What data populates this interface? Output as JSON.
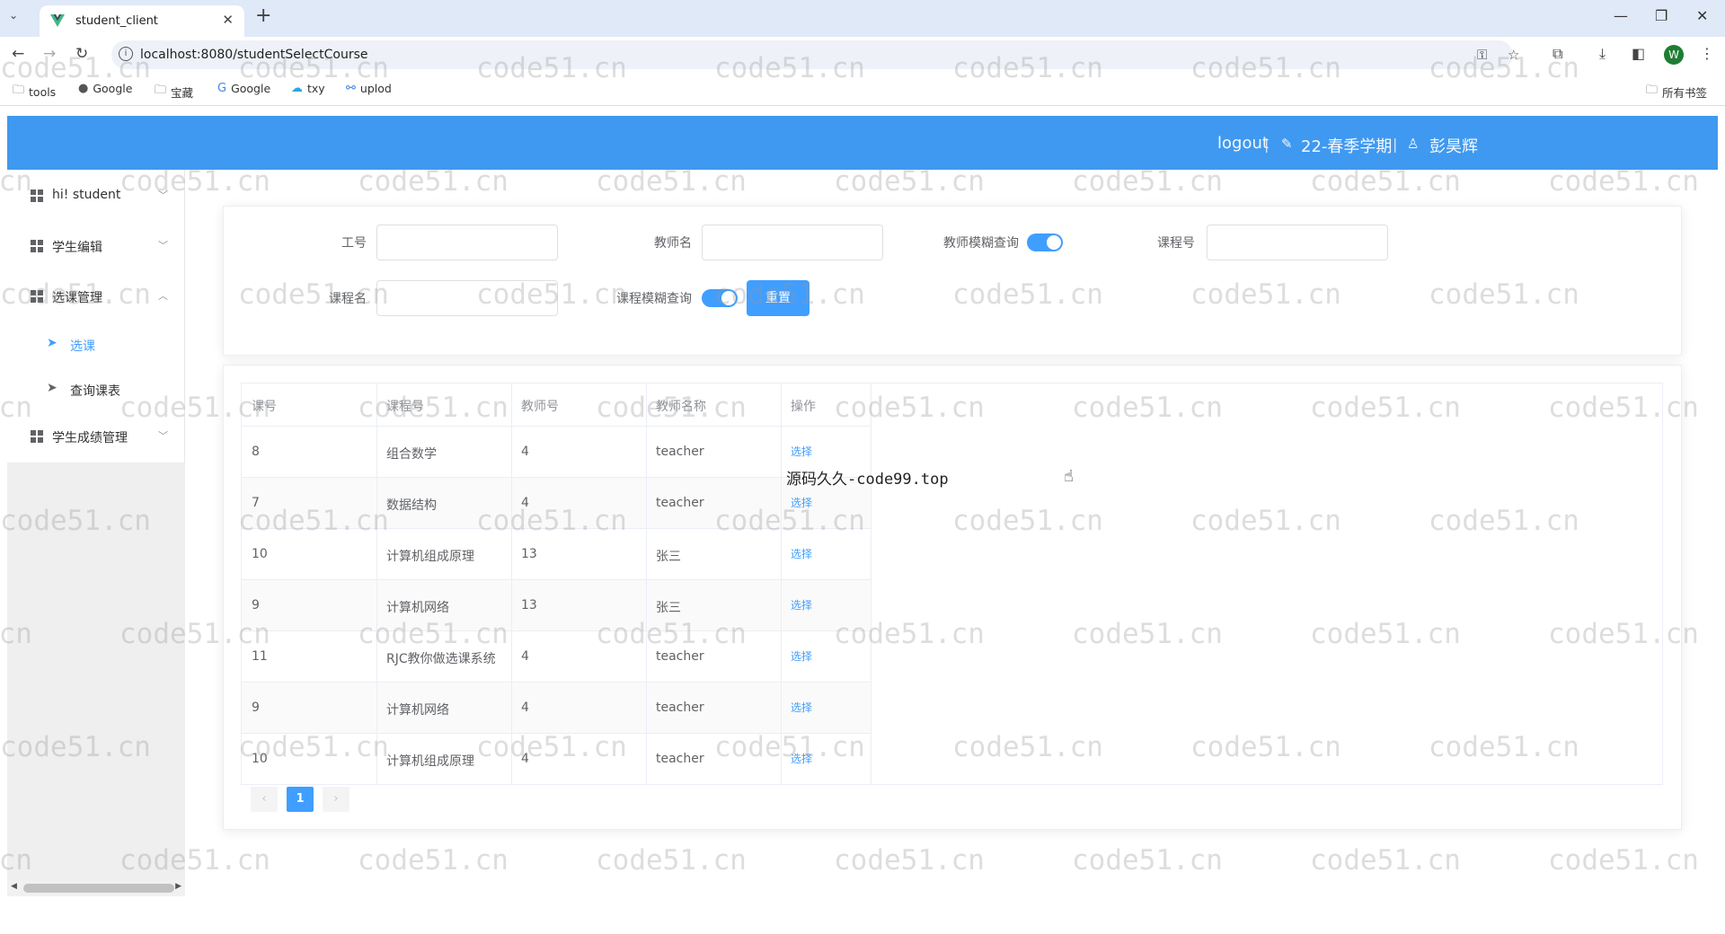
{
  "browser": {
    "tab_title": "student_client",
    "url": "localhost:8080/studentSelectCourse",
    "profile_initial": "W",
    "bookmarks": [
      {
        "label": "tools",
        "icon": "folder-icon"
      },
      {
        "label": "Google",
        "icon": "github-icon"
      },
      {
        "label": "宝藏",
        "icon": "folder-icon"
      },
      {
        "label": "Google",
        "icon": "google-icon"
      },
      {
        "label": "txy",
        "icon": "cloud-icon"
      },
      {
        "label": "uplod",
        "icon": "link-icon"
      }
    ],
    "all_bookmarks_label": "所有书签"
  },
  "header": {
    "logout": "logout",
    "semester": "22-春季学期",
    "user_name": "彭昊辉",
    "separator": "|"
  },
  "sidebar": {
    "items": [
      {
        "label": "hi! student"
      },
      {
        "label": "学生编辑"
      },
      {
        "label": "选课管理"
      },
      {
        "label": "学生成绩管理"
      }
    ],
    "sub_items": [
      {
        "label": "选课",
        "active": true
      },
      {
        "label": "查询课表",
        "active": false
      }
    ]
  },
  "search": {
    "teacher_id_label": "工号",
    "teacher_name_label": "教师名",
    "teacher_fuzzy_label": "教师模糊查询",
    "course_id_label": "课程号",
    "course_name_label": "课程名",
    "course_fuzzy_label": "课程模糊查询",
    "teacher_fuzzy_on": true,
    "course_fuzzy_on": true,
    "reset_label": "重置"
  },
  "table": {
    "columns": [
      "课号",
      "课程号",
      "教师号",
      "教师名称",
      "操作"
    ],
    "action_label": "选择",
    "rows": [
      [
        "8",
        "组合数学",
        "4",
        "teacher"
      ],
      [
        "7",
        "数据结构",
        "4",
        "teacher"
      ],
      [
        "10",
        "计算机组成原理",
        "13",
        "张三"
      ],
      [
        "9",
        "计算机网络",
        "13",
        "张三"
      ],
      [
        "11",
        "RJC教你做选课系统",
        "4",
        "teacher"
      ],
      [
        "9",
        "计算机网络",
        "4",
        "teacher"
      ],
      [
        "10",
        "计算机组成原理",
        "4",
        "teacher"
      ]
    ]
  },
  "pagination": {
    "prev": "‹",
    "current": "1",
    "next": "›"
  },
  "overlay_text": "源码久久-code99.top",
  "watermark_text": "code51.cn",
  "colors": {
    "accent": "#409eff",
    "header_bg": "#3f99f0"
  }
}
